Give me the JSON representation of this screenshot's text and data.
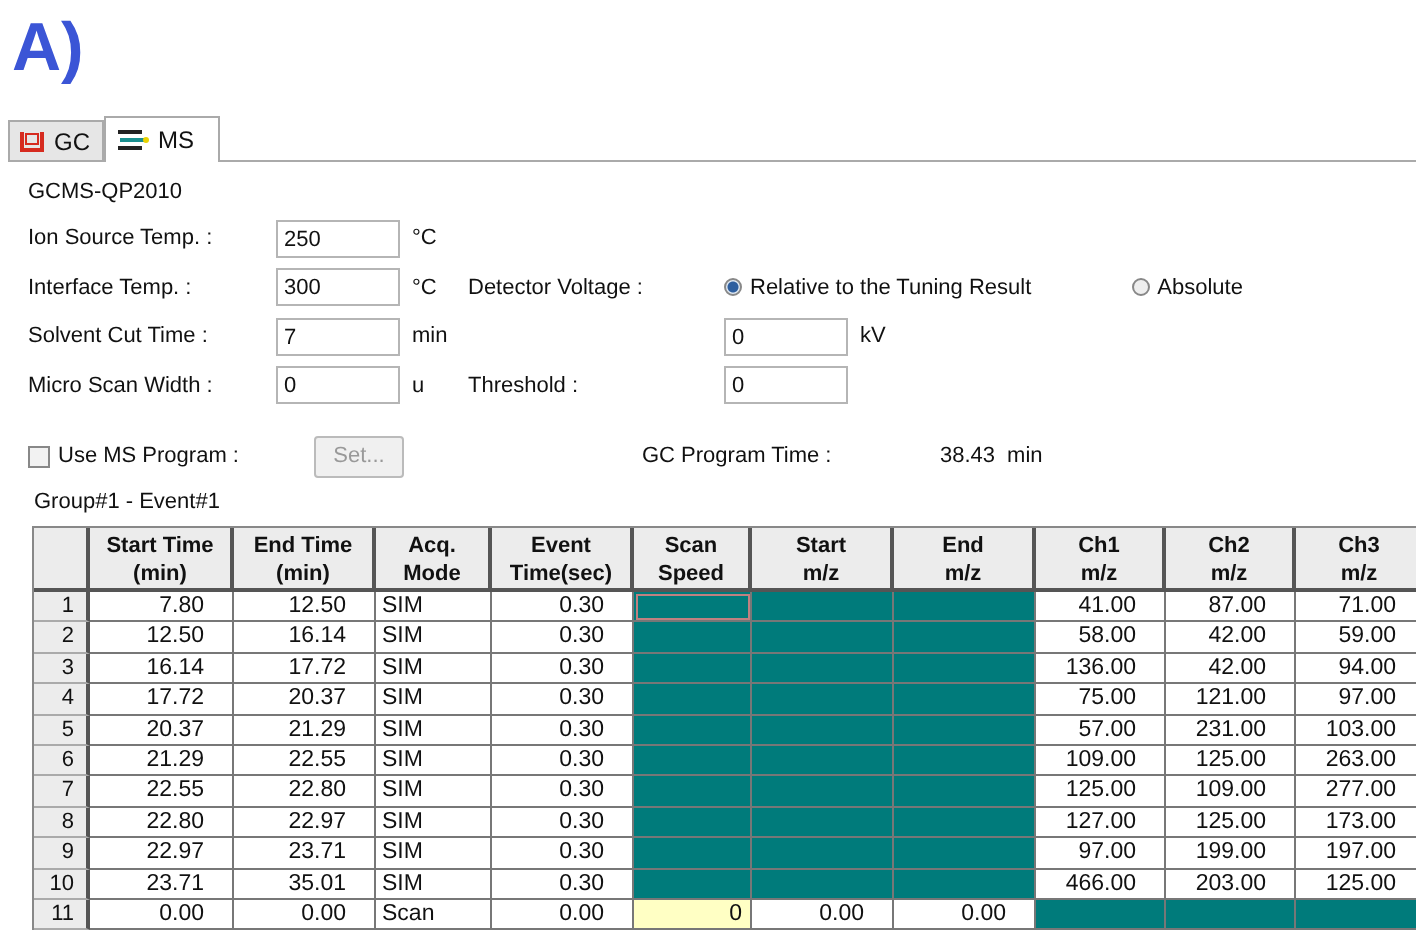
{
  "figure_label": "A)",
  "tabs": [
    {
      "label": "GC",
      "kind": "gc",
      "selected": false
    },
    {
      "label": "MS",
      "kind": "ms",
      "selected": true
    }
  ],
  "instrument": "GCMS-QP2010",
  "fields": [
    {
      "label": "Ion Source Temp. :",
      "value": "250",
      "unit": "°C"
    },
    {
      "label": "Interface Temp. :",
      "value": "300",
      "unit": "°C"
    },
    {
      "label": "Solvent Cut Time :",
      "value": "7",
      "unit": "min"
    },
    {
      "label": "Micro Scan Width :",
      "value": "0",
      "unit": "u"
    }
  ],
  "detector_voltage": {
    "label": "Detector Voltage :",
    "options": [
      {
        "label": "Relative to the Tuning Result",
        "selected": true
      },
      {
        "label": "Absolute",
        "selected": false
      }
    ],
    "value": "0",
    "unit": "kV"
  },
  "threshold": {
    "label": "Threshold :",
    "value": "0"
  },
  "use_ms_program": {
    "label": "Use MS Program :",
    "checked": false
  },
  "set_button": {
    "label": "Set...",
    "disabled": true
  },
  "gc_program_time": {
    "label": "GC Program Time :",
    "value": "38.43",
    "unit": "min"
  },
  "group_label": "Group#1 - Event#1",
  "table": {
    "columns": [
      {
        "line1": "Start Time",
        "line2": "(min)"
      },
      {
        "line1": "End Time",
        "line2": "(min)"
      },
      {
        "line1": "Acq.",
        "line2": "Mode"
      },
      {
        "line1": "Event",
        "line2": "Time(sec)"
      },
      {
        "line1": "Scan",
        "line2": "Speed"
      },
      {
        "line1": "Start",
        "line2": "m/z"
      },
      {
        "line1": "End",
        "line2": "m/z"
      },
      {
        "line1": "Ch1",
        "line2": "m/z"
      },
      {
        "line1": "Ch2",
        "line2": "m/z"
      },
      {
        "line1": "Ch3",
        "line2": "m/z"
      }
    ],
    "rows": [
      {
        "n": "1",
        "cells": [
          {
            "text": "7.80",
            "disabled": false,
            "focused": false
          },
          {
            "text": "12.50",
            "disabled": false,
            "focused": false
          },
          {
            "text": "SIM",
            "disabled": false,
            "focused": false
          },
          {
            "text": "0.30",
            "disabled": false,
            "focused": false
          },
          {
            "disabled": true,
            "focused": true
          },
          {
            "disabled": true,
            "focused": false
          },
          {
            "disabled": true,
            "focused": false
          },
          {
            "text": "41.00",
            "disabled": false,
            "focused": false
          },
          {
            "text": "87.00",
            "disabled": false,
            "focused": false
          },
          {
            "text": "71.00",
            "disabled": false,
            "focused": false
          }
        ]
      },
      {
        "n": "2",
        "cells": [
          {
            "text": "12.50",
            "disabled": false,
            "focused": false
          },
          {
            "text": "16.14",
            "disabled": false,
            "focused": false
          },
          {
            "text": "SIM",
            "disabled": false,
            "focused": false
          },
          {
            "text": "0.30",
            "disabled": false,
            "focused": false
          },
          {
            "disabled": true,
            "focused": false
          },
          {
            "disabled": true,
            "focused": false
          },
          {
            "disabled": true,
            "focused": false
          },
          {
            "text": "58.00",
            "disabled": false,
            "focused": false
          },
          {
            "text": "42.00",
            "disabled": false,
            "focused": false
          },
          {
            "text": "59.00",
            "disabled": false,
            "focused": false
          }
        ]
      },
      {
        "n": "3",
        "cells": [
          {
            "text": "16.14",
            "disabled": false,
            "focused": false
          },
          {
            "text": "17.72",
            "disabled": false,
            "focused": false
          },
          {
            "text": "SIM",
            "disabled": false,
            "focused": false
          },
          {
            "text": "0.30",
            "disabled": false,
            "focused": false
          },
          {
            "disabled": true,
            "focused": false
          },
          {
            "disabled": true,
            "focused": false
          },
          {
            "disabled": true,
            "focused": false
          },
          {
            "text": "136.00",
            "disabled": false,
            "focused": false
          },
          {
            "text": "42.00",
            "disabled": false,
            "focused": false
          },
          {
            "text": "94.00",
            "disabled": false,
            "focused": false
          }
        ]
      },
      {
        "n": "4",
        "cells": [
          {
            "text": "17.72",
            "disabled": false,
            "focused": false
          },
          {
            "text": "20.37",
            "disabled": false,
            "focused": false
          },
          {
            "text": "SIM",
            "disabled": false,
            "focused": false
          },
          {
            "text": "0.30",
            "disabled": false,
            "focused": false
          },
          {
            "disabled": true,
            "focused": false
          },
          {
            "disabled": true,
            "focused": false
          },
          {
            "disabled": true,
            "focused": false
          },
          {
            "text": "75.00",
            "disabled": false,
            "focused": false
          },
          {
            "text": "121.00",
            "disabled": false,
            "focused": false
          },
          {
            "text": "97.00",
            "disabled": false,
            "focused": false
          }
        ]
      },
      {
        "n": "5",
        "cells": [
          {
            "text": "20.37",
            "disabled": false,
            "focused": false
          },
          {
            "text": "21.29",
            "disabled": false,
            "focused": false
          },
          {
            "text": "SIM",
            "disabled": false,
            "focused": false
          },
          {
            "text": "0.30",
            "disabled": false,
            "focused": false
          },
          {
            "disabled": true,
            "focused": false
          },
          {
            "disabled": true,
            "focused": false
          },
          {
            "disabled": true,
            "focused": false
          },
          {
            "text": "57.00",
            "disabled": false,
            "focused": false
          },
          {
            "text": "231.00",
            "disabled": false,
            "focused": false
          },
          {
            "text": "103.00",
            "disabled": false,
            "focused": false
          }
        ]
      },
      {
        "n": "6",
        "cells": [
          {
            "text": "21.29",
            "disabled": false,
            "focused": false
          },
          {
            "text": "22.55",
            "disabled": false,
            "focused": false
          },
          {
            "text": "SIM",
            "disabled": false,
            "focused": false
          },
          {
            "text": "0.30",
            "disabled": false,
            "focused": false
          },
          {
            "disabled": true,
            "focused": false
          },
          {
            "disabled": true,
            "focused": false
          },
          {
            "disabled": true,
            "focused": false
          },
          {
            "text": "109.00",
            "disabled": false,
            "focused": false
          },
          {
            "text": "125.00",
            "disabled": false,
            "focused": false
          },
          {
            "text": "263.00",
            "disabled": false,
            "focused": false
          }
        ]
      },
      {
        "n": "7",
        "cells": [
          {
            "text": "22.55",
            "disabled": false,
            "focused": false
          },
          {
            "text": "22.80",
            "disabled": false,
            "focused": false
          },
          {
            "text": "SIM",
            "disabled": false,
            "focused": false
          },
          {
            "text": "0.30",
            "disabled": false,
            "focused": false
          },
          {
            "disabled": true,
            "focused": false
          },
          {
            "disabled": true,
            "focused": false
          },
          {
            "disabled": true,
            "focused": false
          },
          {
            "text": "125.00",
            "disabled": false,
            "focused": false
          },
          {
            "text": "109.00",
            "disabled": false,
            "focused": false
          },
          {
            "text": "277.00",
            "disabled": false,
            "focused": false
          }
        ]
      },
      {
        "n": "8",
        "cells": [
          {
            "text": "22.80",
            "disabled": false,
            "focused": false
          },
          {
            "text": "22.97",
            "disabled": false,
            "focused": false
          },
          {
            "text": "SIM",
            "disabled": false,
            "focused": false
          },
          {
            "text": "0.30",
            "disabled": false,
            "focused": false
          },
          {
            "disabled": true,
            "focused": false
          },
          {
            "disabled": true,
            "focused": false
          },
          {
            "disabled": true,
            "focused": false
          },
          {
            "text": "127.00",
            "disabled": false,
            "focused": false
          },
          {
            "text": "125.00",
            "disabled": false,
            "focused": false
          },
          {
            "text": "173.00",
            "disabled": false,
            "focused": false
          }
        ]
      },
      {
        "n": "9",
        "cells": [
          {
            "text": "22.97",
            "disabled": false,
            "focused": false
          },
          {
            "text": "23.71",
            "disabled": false,
            "focused": false
          },
          {
            "text": "SIM",
            "disabled": false,
            "focused": false
          },
          {
            "text": "0.30",
            "disabled": false,
            "focused": false
          },
          {
            "disabled": true,
            "focused": false
          },
          {
            "disabled": true,
            "focused": false
          },
          {
            "disabled": true,
            "focused": false
          },
          {
            "text": "97.00",
            "disabled": false,
            "focused": false
          },
          {
            "text": "199.00",
            "disabled": false,
            "focused": false
          },
          {
            "text": "197.00",
            "disabled": false,
            "focused": false
          }
        ]
      },
      {
        "n": "10",
        "cells": [
          {
            "text": "23.71",
            "disabled": false,
            "focused": false
          },
          {
            "text": "35.01",
            "disabled": false,
            "focused": false
          },
          {
            "text": "SIM",
            "disabled": false,
            "focused": false
          },
          {
            "text": "0.30",
            "disabled": false,
            "focused": false
          },
          {
            "disabled": true,
            "focused": false
          },
          {
            "disabled": true,
            "focused": false
          },
          {
            "disabled": true,
            "focused": false
          },
          {
            "text": "466.00",
            "disabled": false,
            "focused": false
          },
          {
            "text": "203.00",
            "disabled": false,
            "focused": false
          },
          {
            "text": "125.00",
            "disabled": false,
            "focused": false
          }
        ]
      },
      {
        "n": "11",
        "cells": [
          {
            "text": "0.00",
            "disabled": false,
            "focused": false
          },
          {
            "text": "0.00",
            "disabled": false,
            "focused": false
          },
          {
            "text": "Scan",
            "disabled": false,
            "focused": false
          },
          {
            "text": "0.00",
            "disabled": false,
            "focused": false
          },
          {
            "text": "0",
            "disabled": false,
            "focused": true
          },
          {
            "text": "0.00",
            "disabled": false,
            "focused": false
          },
          {
            "text": "0.00",
            "disabled": false,
            "focused": false
          },
          {
            "disabled": true,
            "focused": false
          },
          {
            "disabled": true,
            "focused": false
          },
          {
            "disabled": true,
            "focused": false
          }
        ]
      }
    ]
  }
}
